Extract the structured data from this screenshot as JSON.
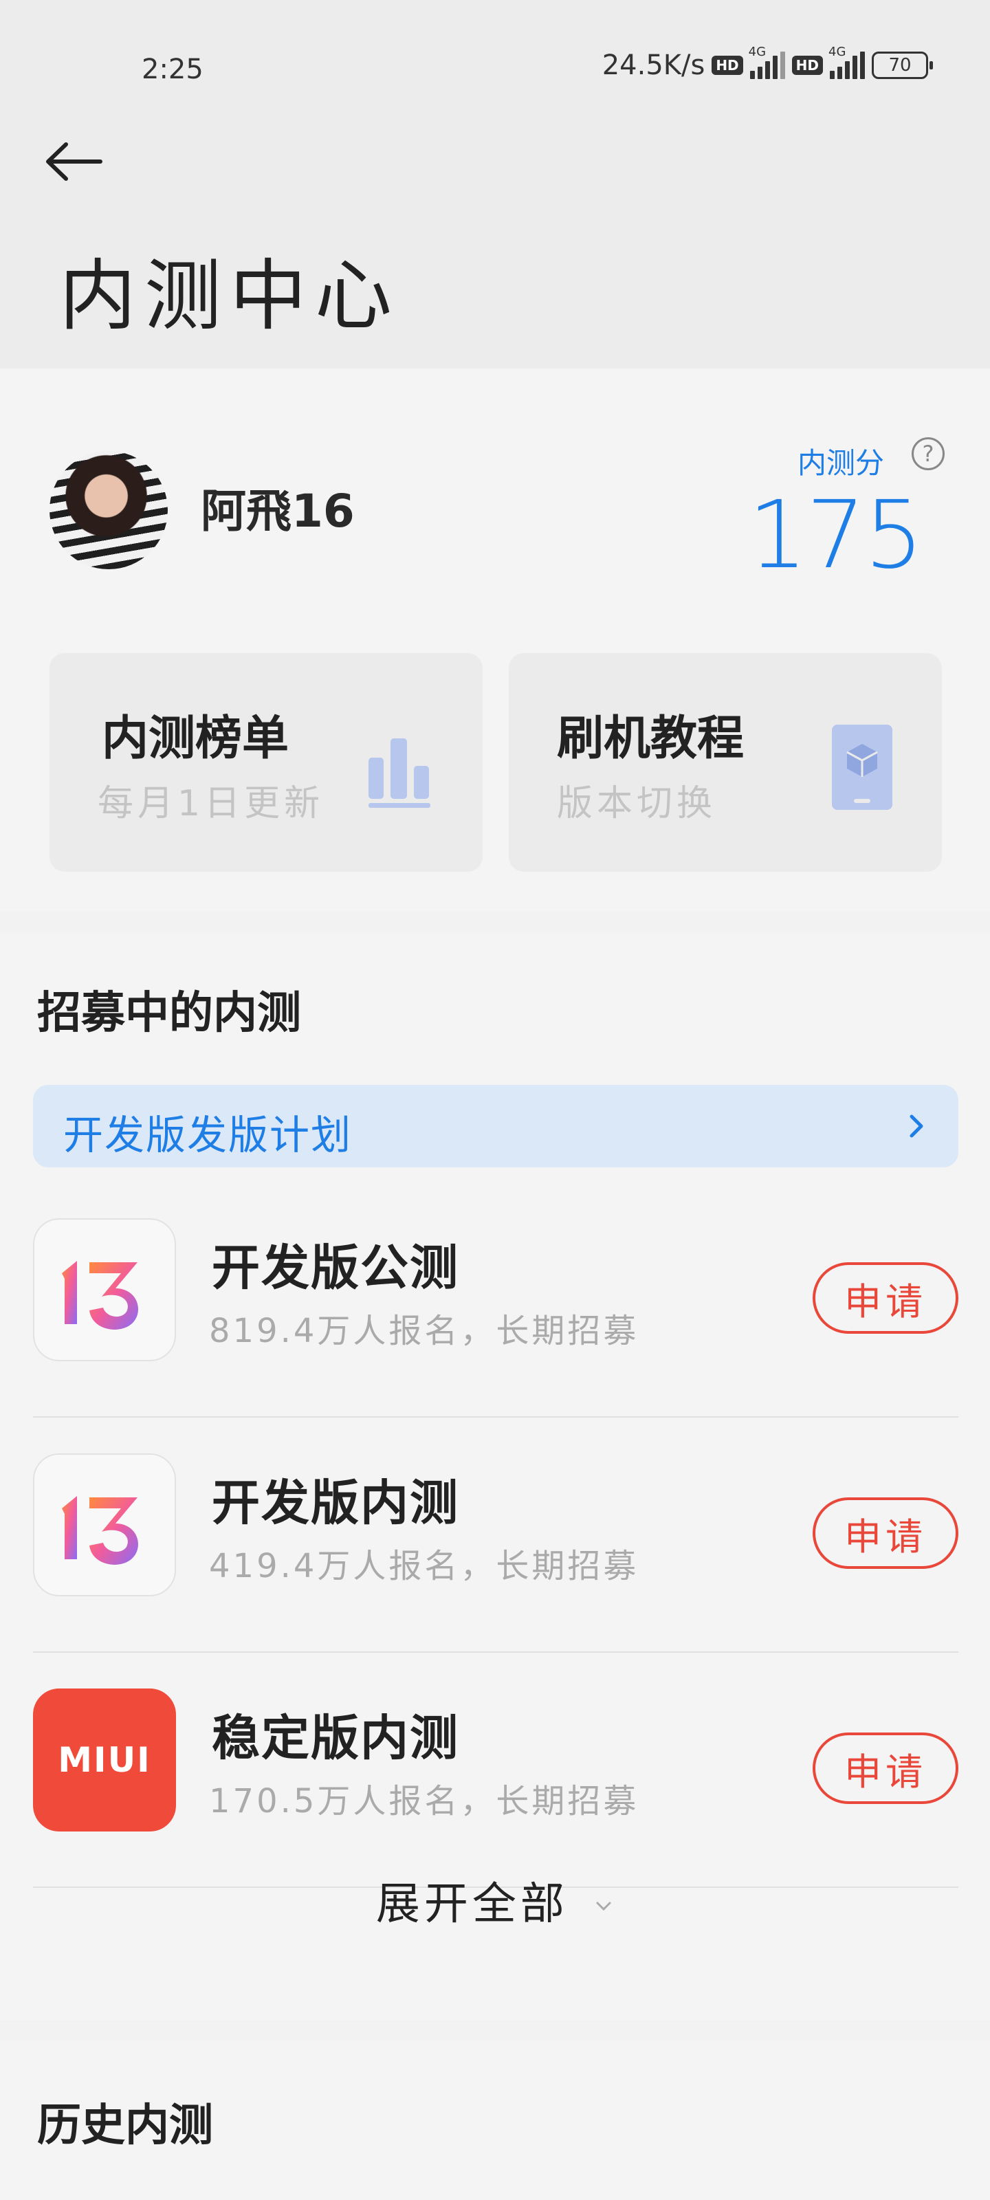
{
  "status_bar": {
    "time": "2:25",
    "network_speed": "24.5K/s",
    "hd_badge": "HD",
    "net_type": "4G",
    "battery": "70"
  },
  "header": {
    "back_icon": "arrow-left-icon",
    "title": "内测中心"
  },
  "profile": {
    "username": "阿飛16",
    "score_label": "内测分",
    "score": "175",
    "help_icon": "question-icon",
    "help_glyph": "?"
  },
  "tiles": [
    {
      "title": "内测榜单",
      "subtitle": "每月1日更新",
      "icon": "bar-chart-icon"
    },
    {
      "title": "刷机教程",
      "subtitle": "版本切换",
      "icon": "phone-box-icon"
    }
  ],
  "recruiting": {
    "title": "招募中的内测",
    "plan_banner": "开发版发版计划",
    "items": [
      {
        "name": "开发版公测",
        "desc": "819.4万人报名，长期招募",
        "action": "申请",
        "icon": "miui13-icon"
      },
      {
        "name": "开发版内测",
        "desc": "419.4万人报名，长期招募",
        "action": "申请",
        "icon": "miui13-icon"
      },
      {
        "name": "稳定版内测",
        "desc": "170.5万人报名，长期招募",
        "action": "申请",
        "icon": "miui-icon",
        "icon_text": "MIUI"
      }
    ],
    "expand_label": "展开全部"
  },
  "history": {
    "title": "历史内测"
  },
  "colors": {
    "accent_blue": "#1e7ee6",
    "apply_red": "#e8473a",
    "miui_red": "#f04a3a"
  }
}
